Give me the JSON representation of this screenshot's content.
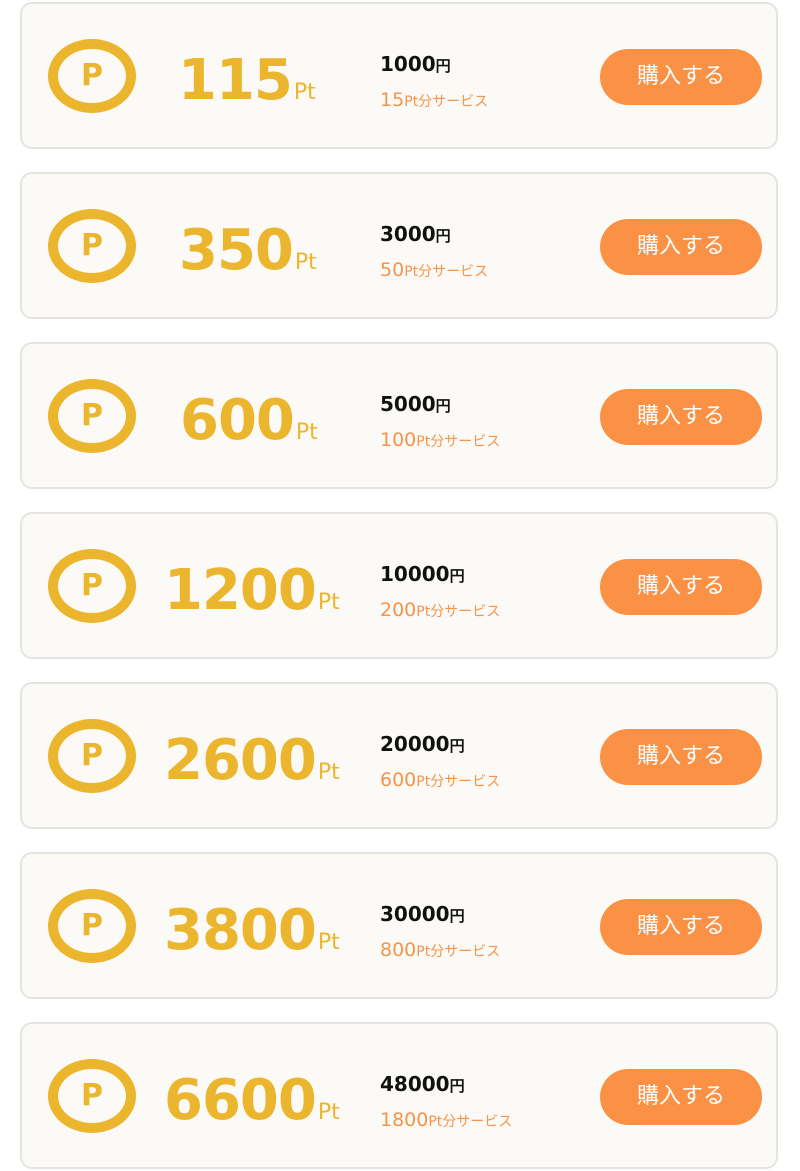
{
  "packages": [
    {
      "points": "115",
      "unit": "Pt",
      "price": "1000",
      "yen": "円",
      "bonus": "15",
      "bonus_suffix": "Pt分サービス",
      "button_label": "購入する"
    },
    {
      "points": "350",
      "unit": "Pt",
      "price": "3000",
      "yen": "円",
      "bonus": "50",
      "bonus_suffix": "Pt分サービス",
      "button_label": "購入する"
    },
    {
      "points": "600",
      "unit": "Pt",
      "price": "5000",
      "yen": "円",
      "bonus": "100",
      "bonus_suffix": "Pt分サービス",
      "button_label": "購入する"
    },
    {
      "points": "1200",
      "unit": "Pt",
      "price": "10000",
      "yen": "円",
      "bonus": "200",
      "bonus_suffix": "Pt分サービス",
      "button_label": "購入する"
    },
    {
      "points": "2600",
      "unit": "Pt",
      "price": "20000",
      "yen": "円",
      "bonus": "600",
      "bonus_suffix": "Pt分サービス",
      "button_label": "購入する"
    },
    {
      "points": "3800",
      "unit": "Pt",
      "price": "30000",
      "yen": "円",
      "bonus": "800",
      "bonus_suffix": "Pt分サービス",
      "button_label": "購入する"
    },
    {
      "points": "6600",
      "unit": "Pt",
      "price": "48000",
      "yen": "円",
      "bonus": "1800",
      "bonus_suffix": "Pt分サービス",
      "button_label": "購入する"
    }
  ],
  "icon": {
    "name": "point-icon",
    "letter": "P"
  },
  "colors": {
    "gold": "#ebb52d",
    "orange_text": "#f5944b",
    "button": "#fb9145",
    "card_bg": "#fcfaf6",
    "card_border": "#e6e4e0"
  }
}
